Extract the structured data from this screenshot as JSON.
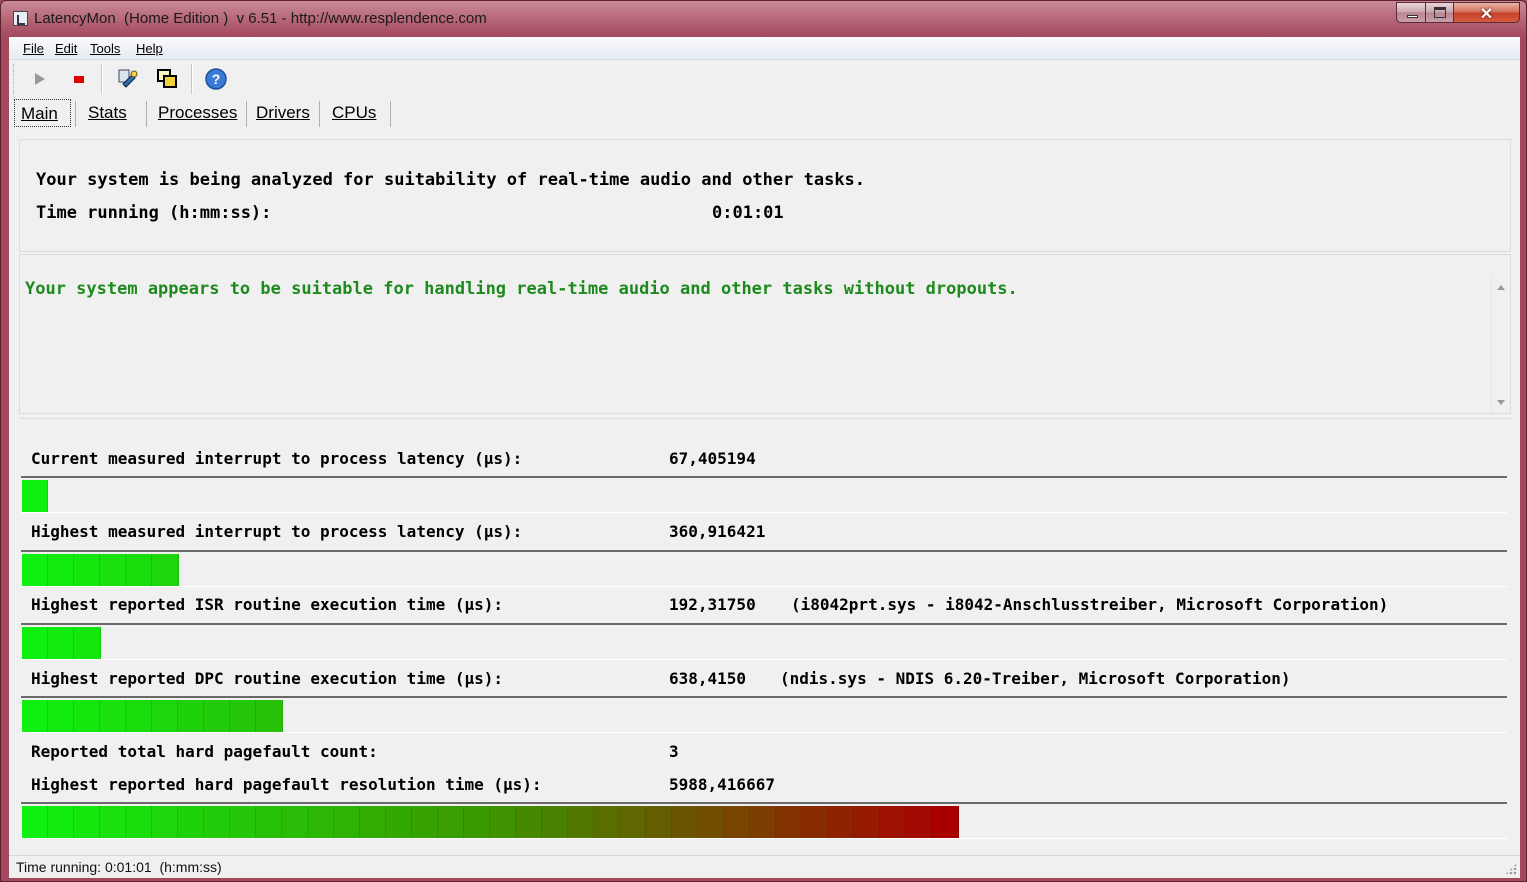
{
  "window": {
    "title": "LatencyMon  (Home Edition )  v 6.51 - http://www.resplendence.com",
    "controls": {
      "minimize": "minimize-icon",
      "maximize": "maximize-icon",
      "close": "close-icon"
    }
  },
  "menu": [
    {
      "label": "File"
    },
    {
      "label": "Edit"
    },
    {
      "label": "Tools"
    },
    {
      "label": "Help"
    }
  ],
  "toolbar": {
    "buttons": [
      "play-icon",
      "stop-icon",
      "tools-wrench-icon",
      "windows-icon",
      "help-icon"
    ]
  },
  "tabs": [
    {
      "label": "Main",
      "active": true
    },
    {
      "label": "Stats",
      "active": false
    },
    {
      "label": "Processes",
      "active": false
    },
    {
      "label": "Drivers",
      "active": false
    },
    {
      "label": "CPUs",
      "active": false
    }
  ],
  "main": {
    "analyzing_text": "Your system is being analyzed for suitability of real-time audio and other tasks.",
    "time_running_label": "Time running (h:mm:ss):",
    "time_running_value": "0:01:01",
    "verdict_text": "Your system appears to be suitable for handling real-time audio and other tasks without dropouts.",
    "verdict_color": "#1d8a1d",
    "metrics": [
      {
        "label": "Current measured interrupt to process latency (µs):",
        "value": "67,405194",
        "extra": "",
        "bar_segments": 1
      },
      {
        "label": "Highest measured interrupt to process latency (µs):",
        "value": "360,916421",
        "extra": "",
        "bar_segments": 6
      },
      {
        "label": "Highest reported ISR routine execution time (µs):",
        "value": "192,31750",
        "extra": "(i8042prt.sys - i8042-Anschlusstreiber, Microsoft Corporation)",
        "bar_segments": 3
      },
      {
        "label": "Highest reported DPC routine execution time (µs):",
        "value": "638,4150",
        "extra": "(ndis.sys - NDIS 6.20-Treiber, Microsoft Corporation)",
        "bar_segments": 10
      },
      {
        "label": "Reported total hard pagefault count:",
        "value": "3",
        "extra": ""
      },
      {
        "label": "Highest reported hard pagefault resolution time (µs):",
        "value": "5988,416667",
        "extra": "",
        "bar_segments": 36
      }
    ],
    "bar_colors": {
      "start": "#10f010",
      "end": "#a80000"
    }
  },
  "status": {
    "text": "Time running: 0:01:01  (h:mm:ss)"
  }
}
